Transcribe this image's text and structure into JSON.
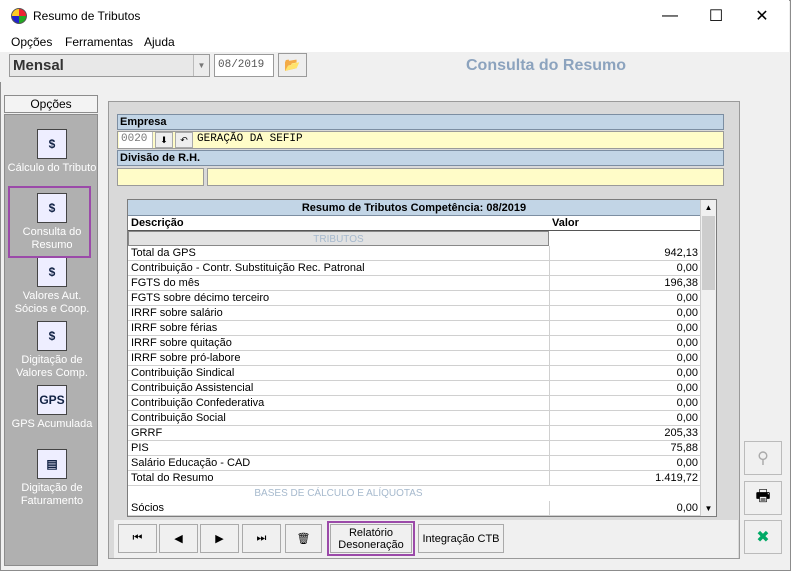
{
  "window": {
    "title": "Resumo de Tributos",
    "minimize": "—",
    "maximize": "☐",
    "close": "✕"
  },
  "menu": {
    "items": [
      "Opções",
      "Ferramentas",
      "Ajuda"
    ]
  },
  "toolbar": {
    "period": "Mensal",
    "competence": "08/2019",
    "page_title": "Consulta do Resumo"
  },
  "sidebar": {
    "header": "Opções",
    "items": [
      {
        "label": "Cálculo do Tributo",
        "icon": "calculator-document-icon"
      },
      {
        "label": "Consulta do Resumo",
        "icon": "query-summary-icon"
      },
      {
        "label": "Valores Aut. Sócios e Coop.",
        "icon": "partners-values-icon"
      },
      {
        "label": "Digitação de Valores Comp.",
        "icon": "typing-values-icon"
      },
      {
        "label": "GPS Acumulada",
        "icon": "gps-icon"
      },
      {
        "label": "Digitação de Faturamento",
        "icon": "billing-icon"
      }
    ]
  },
  "empresa": {
    "label": "Empresa",
    "code": "0020",
    "name": "GERAÇÃO DA SEFIP"
  },
  "divisao": {
    "label": "Divisão de R.H."
  },
  "grid": {
    "title": "Resumo de Tributos Competência: 08/2019",
    "col_desc": "Descrição",
    "col_value": "Valor",
    "section1": "TRIBUTOS",
    "rows": [
      {
        "d": "Total da GPS",
        "v": "942,13"
      },
      {
        "d": "Contribuição - Contr. Substituição Rec. Patronal",
        "v": "0,00"
      },
      {
        "d": "FGTS do mês",
        "v": "196,38"
      },
      {
        "d": "FGTS sobre décimo terceiro",
        "v": "0,00"
      },
      {
        "d": "IRRF sobre salário",
        "v": "0,00"
      },
      {
        "d": "IRRF sobre férias",
        "v": "0,00"
      },
      {
        "d": "IRRF sobre quitação",
        "v": "0,00"
      },
      {
        "d": "IRRF sobre pró-labore",
        "v": "0,00"
      },
      {
        "d": "Contribuição Sindical",
        "v": "0,00"
      },
      {
        "d": "Contribuição Assistencial",
        "v": "0,00"
      },
      {
        "d": "Contribuição Confederativa",
        "v": "0,00"
      },
      {
        "d": "Contribuição Social",
        "v": "0,00"
      },
      {
        "d": "GRRF",
        "v": "205,33"
      },
      {
        "d": "PIS",
        "v": "75,88"
      },
      {
        "d": "Salário Educação - CAD",
        "v": "0,00"
      },
      {
        "d": "Total do Resumo",
        "v": "1.419,72"
      }
    ],
    "section2": "BASES DE CÁLCULO E ALÍQUOTAS",
    "rows2": [
      {
        "d": "Sócios",
        "v": "0,00"
      }
    ]
  },
  "bottom": {
    "relatorio": "Relatório Desoneração",
    "integracao": "Integração CTB"
  },
  "highlight_color": "#9b4aa9"
}
